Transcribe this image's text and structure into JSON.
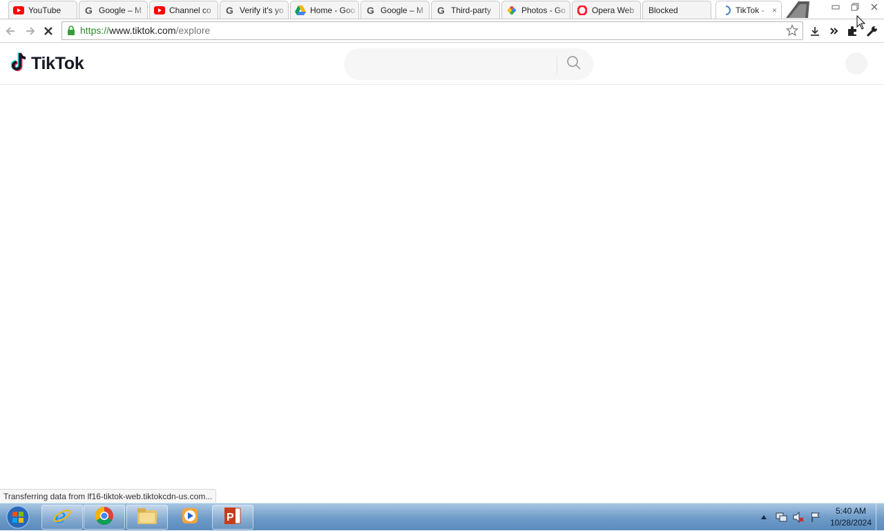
{
  "browser": {
    "tabs": [
      {
        "title": "YouTube",
        "icon": "youtube-icon",
        "active": false
      },
      {
        "title": "Google – M",
        "icon": "google-icon",
        "active": false
      },
      {
        "title": "Channel co",
        "icon": "youtube-icon",
        "active": false
      },
      {
        "title": "Verify it's yo",
        "icon": "google-icon",
        "active": false
      },
      {
        "title": "Home - Goo",
        "icon": "drive-icon",
        "active": false
      },
      {
        "title": "Google – M",
        "icon": "google-icon",
        "active": false
      },
      {
        "title": "Third-party",
        "icon": "google-icon",
        "active": false
      },
      {
        "title": "Photos - Go",
        "icon": "photos-icon",
        "active": false
      },
      {
        "title": "Opera Web",
        "icon": "opera-icon",
        "active": false
      },
      {
        "title": "Blocked",
        "icon": "",
        "active": false
      },
      {
        "title": "TikTok - ",
        "icon": "loading-spinner-icon",
        "active": true,
        "close": "×"
      }
    ],
    "url": {
      "scheme": "https://",
      "host": "www.tiktok.com",
      "path": "/explore"
    },
    "status_text": "Transferring data from lf16-tiktok-web.tiktokcdn-us.com..."
  },
  "page": {
    "logo_text": "TikTok",
    "search_placeholder": ""
  },
  "taskbar": {
    "apps": [
      "internet-explorer-icon",
      "chrome-icon",
      "file-explorer-icon",
      "media-player-icon",
      "powerpoint-icon"
    ],
    "clock_time": "5:40 AM",
    "clock_date": "10/28/2024"
  },
  "colors": {
    "accent_green": "#2e8b2e",
    "tiktok_text": "#161823",
    "taskbar": "#6d9ac7"
  }
}
